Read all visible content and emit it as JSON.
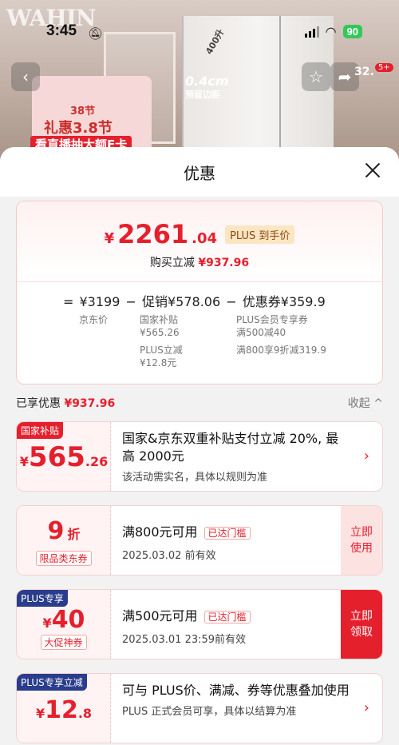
{
  "status": {
    "time": "3:45",
    "battery": "90"
  },
  "background": {
    "brand": "WAHIN",
    "badge_38": "38节",
    "gift_title": "礼惠3.8节",
    "gift_sub": "看直播抽大额E卡",
    "gap_value": "0.4cm",
    "gap_label": "预留边距",
    "height_label": "400升",
    "cart_count": "32.",
    "cart_badge": "5+"
  },
  "sheet": {
    "title": "优惠",
    "summary": {
      "price_symbol": "¥",
      "price_int": "2261",
      "price_dec": ".04",
      "plus_tag": "PLUS 到手价",
      "reduce_label": "购买立减",
      "reduce_value": "¥937.96",
      "formula": {
        "eq": "=",
        "jd_price": "¥3199",
        "minus1": "−",
        "promo": "促销¥578.06",
        "minus2": "−",
        "coupon": "优惠券¥359.9"
      },
      "jd_price_label": "京东价",
      "promo_items": [
        "国家补贴",
        "¥565.26",
        "PLUS立减",
        "¥12.8元"
      ],
      "coupon_items": [
        "PLUS会员专享券",
        "满500减40",
        "满800享9折减319.9"
      ]
    },
    "enjoyed_label": "已享优惠",
    "enjoyed_value": "¥937.96",
    "collapse_label": "收起 ^",
    "cards": [
      {
        "tag": "国家补贴",
        "amount_symbol": "¥",
        "amount_int": "565",
        "amount_dec": ".26",
        "title": "国家&京东双重补贴支付立减 20%, 最高 2000元",
        "desc": "该活动需实名，具体以规则为准"
      },
      {
        "amount_int": "9",
        "amount_unit": "折",
        "label": "限品类东券",
        "title": "满800元可用",
        "met": "已达门槛",
        "desc": "2025.03.02 前有效",
        "action": "立即使用"
      },
      {
        "tag": "PLUS专享",
        "amount_symbol": "¥",
        "amount_int": "40",
        "label": "大促神券",
        "title": "满500元可用",
        "met": "已达门槛",
        "desc": "2025.03.01 23:59前有效",
        "action": "立即领取"
      },
      {
        "tag": "PLUS专享立减",
        "amount_symbol": "¥",
        "amount_int": "12",
        "amount_dec": ".8",
        "title": "可与 PLUS价、满减、券等优惠叠加使用",
        "desc": "PLUS 正式会员可享，具体以结算为准"
      }
    ]
  },
  "colors": {
    "accent": "#e5202d",
    "plus_blue": "#2a3d8c",
    "battery": "#34c759"
  }
}
